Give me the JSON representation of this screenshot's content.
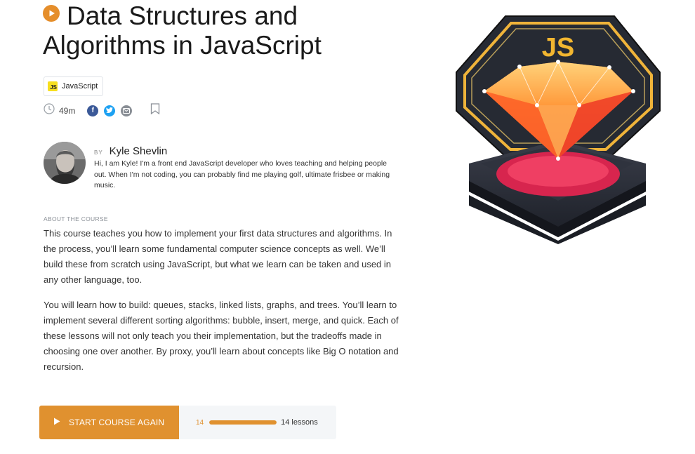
{
  "course": {
    "title": "Data Structures and Algorithms in JavaScript",
    "tag": "JavaScript",
    "tag_logo_text": "JS",
    "duration": "49m",
    "accent_color": "#e58e2b"
  },
  "author": {
    "by_label": "BY",
    "name": "Kyle Shevlin",
    "bio": "Hi, I am Kyle! I'm a front end JavaScript developer who loves teaching and helping people out. When I'm not coding, you can probably find me playing golf, ultimate frisbee or making music."
  },
  "about": {
    "label": "ABOUT THE COURSE",
    "paragraphs": [
      "This course teaches you how to implement your first data structures and algorithms. In the process, you’ll learn some fundamental computer science concepts as well. We’ll build these from scratch using JavaScript, but what we learn can be taken and used in any other language, too.",
      "You will learn how to build: queues, stacks, linked lists, graphs, and trees. You’ll learn to implement several different sorting algorithms: bubble, insert, merge, and quick. Each of these lessons will not only teach you their implementation, but the tradeoffs made in choosing one over another. By proxy, you’ll learn about concepts like Big O notation and recursion."
    ]
  },
  "action": {
    "start_label": "START COURSE AGAIN",
    "progress_completed": "14",
    "progress_total_label": "14 lessons",
    "progress_fraction": 1.0
  },
  "icons": {
    "title_play": "play-circle-icon",
    "clock": "clock-icon",
    "facebook": "facebook-icon",
    "twitter": "twitter-icon",
    "email": "email-icon",
    "bookmark": "bookmark-icon",
    "hero_image_logo": "JS"
  }
}
